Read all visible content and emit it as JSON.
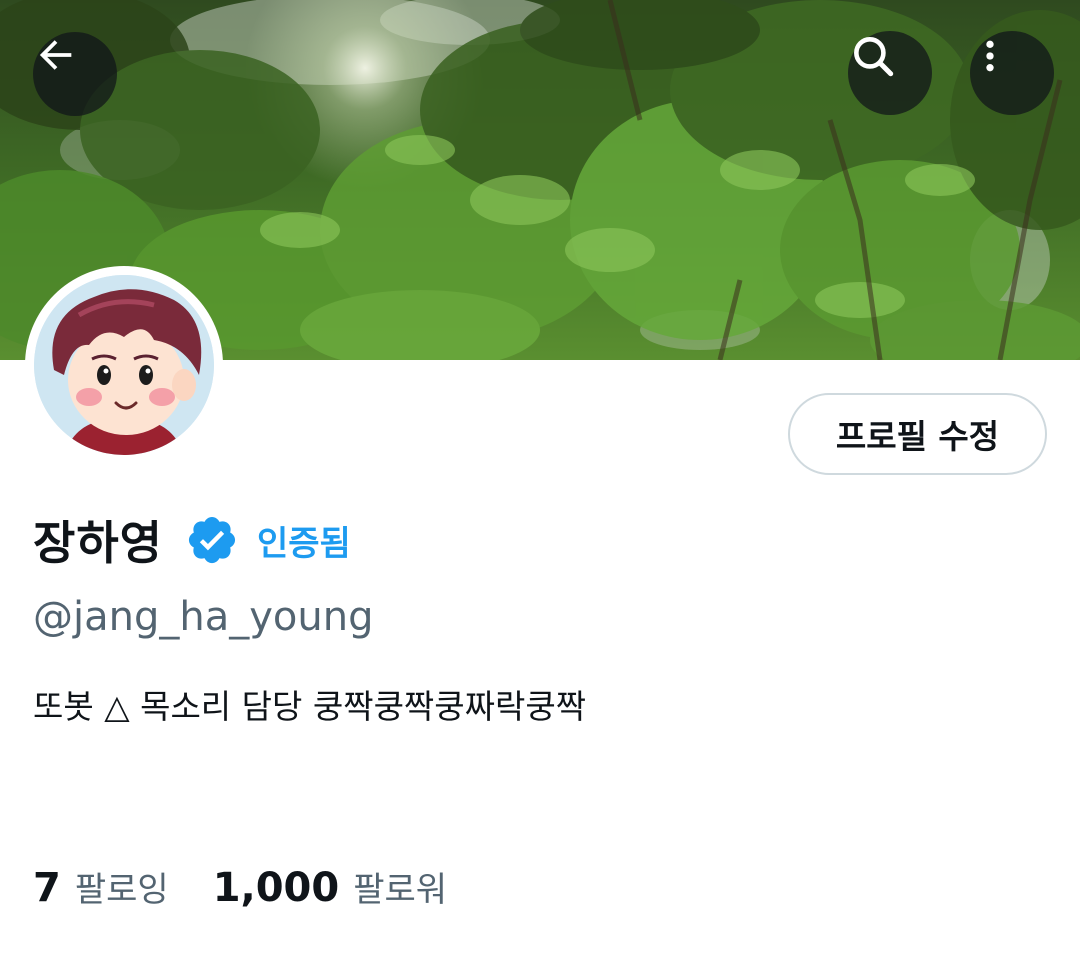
{
  "header": {
    "back_icon": "arrow-left-icon",
    "search_icon": "search-icon",
    "more_icon": "more-vertical-icon"
  },
  "profile": {
    "display_name": "장하영",
    "verified_label": "인증됨",
    "handle": "@jang_ha_young",
    "bio": "또봇 △ 목소리 담당 쿵짝쿵짝쿵짜락쿵짝",
    "edit_button_label": "프로필 수정"
  },
  "stats": {
    "following_count": "7",
    "following_label": "팔로잉",
    "followers_count": "1,000",
    "followers_label": "팔로워"
  },
  "colors": {
    "accent": "#1d9bf0",
    "secondary_text": "#536471",
    "primary_text": "#0f1419",
    "border": "#cfd9de"
  }
}
